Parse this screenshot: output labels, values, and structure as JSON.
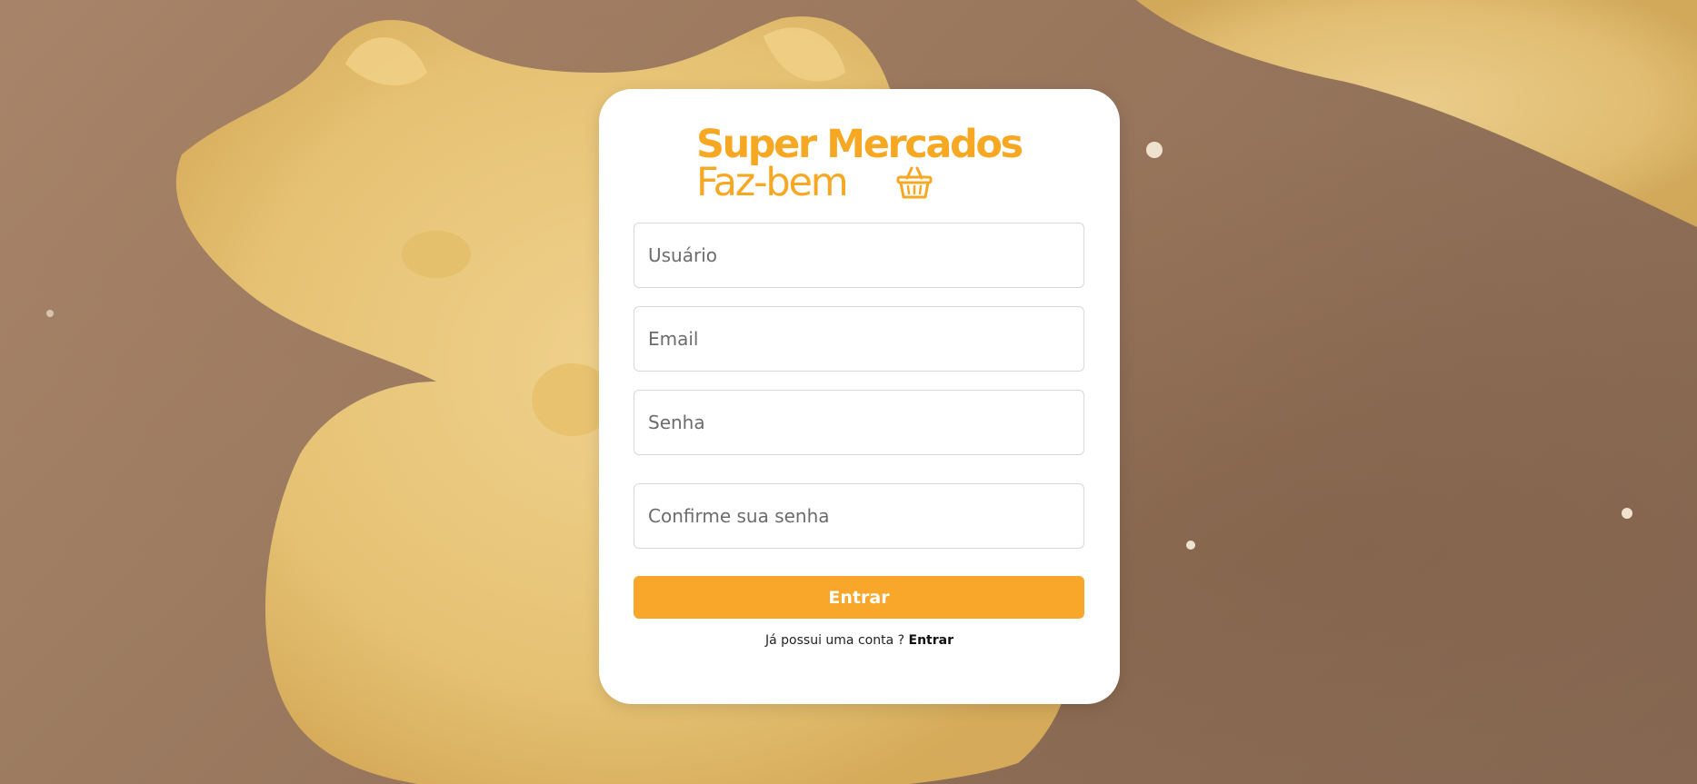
{
  "logo": {
    "line1": "Super Mercados",
    "line2": "Faz-bem",
    "icon": "basket-icon"
  },
  "form": {
    "username_placeholder": "Usuário",
    "email_placeholder": "Email",
    "password_placeholder": "Senha",
    "confirm_placeholder": "Confirme sua senha",
    "submit_label": "Entrar"
  },
  "footer": {
    "prompt": "Já possui uma conta ? ",
    "link_label": "Entrar"
  },
  "colors": {
    "brand": "#f7a823",
    "button": "#f8a72b"
  }
}
